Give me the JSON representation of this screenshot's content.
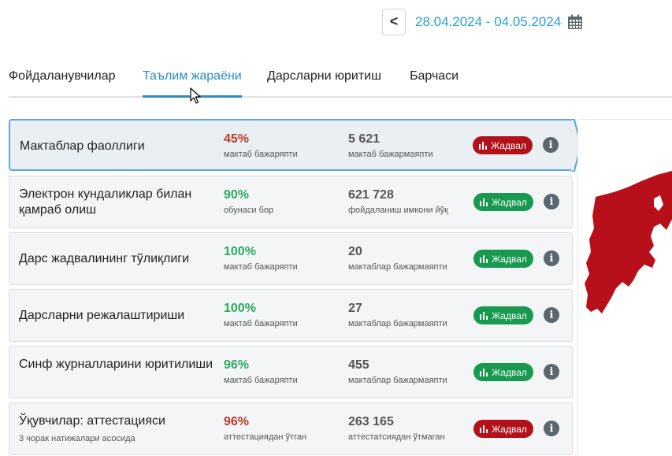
{
  "header": {
    "back_label": "<",
    "date_range": "28.04.2024 - 04.05.2024"
  },
  "tabs": [
    {
      "label": "Фойдаланувчилар"
    },
    {
      "label": "Таълим жараёни"
    },
    {
      "label": "Дарсларни юритиш"
    },
    {
      "label": "Барчаси"
    }
  ],
  "active_tab": "Таълим жараёни",
  "colors": {
    "accent": "#2a8cbf",
    "badge_red": "#b3111a",
    "badge_green": "#18994f",
    "map_red": "#b8101a"
  },
  "cards": [
    {
      "title": "Мактаблар фаоллиги",
      "subtitle": "",
      "pct": "45%",
      "pct_label": "мактаб бажаряпти",
      "pct_color": "red",
      "count": "5 621",
      "count_label": "мактаб бажармаяпти",
      "badge": "Жадвал",
      "badge_color": "red"
    },
    {
      "title": "Электрон кундаликлар билан қамраб олиш",
      "subtitle": "",
      "pct": "90%",
      "pct_label": "обунаси бор",
      "pct_color": "green",
      "count": "621 728",
      "count_label": "фойдаланиш имкони йўқ",
      "badge": "Жадвал",
      "badge_color": "green"
    },
    {
      "title": "Дарс жадвалининг тўлиқлиги",
      "subtitle": "",
      "pct": "100%",
      "pct_label": "мактаб бажаряпти",
      "pct_color": "green",
      "count": "20",
      "count_label": "мактаблар бажармаяпти",
      "badge": "Жадвал",
      "badge_color": "green"
    },
    {
      "title": "Дарсларни режалаштириши",
      "subtitle": "",
      "pct": "100%",
      "pct_label": "мактаб бажаряпти",
      "pct_color": "green",
      "count": "27",
      "count_label": "мактаблар бажармаяпти",
      "badge": "Жадвал",
      "badge_color": "green"
    },
    {
      "title": "Синф журналларини юритилиши",
      "subtitle": "",
      "pct": "96%",
      "pct_label": "мактаб бажаряпти",
      "pct_color": "green",
      "count": "455",
      "count_label": "мактаблар бажармаяпти",
      "badge": "Жадвал",
      "badge_color": "green"
    },
    {
      "title": "Ўқувчилар: аттестацияси",
      "subtitle": "3 чорак натижалари асосида",
      "pct": "96%",
      "pct_label": "аттестациядан ўтган",
      "pct_color": "red",
      "count": "263 165",
      "count_label": "аттестатсиядан ўтмаган",
      "badge": "Жадвал",
      "badge_color": "red"
    }
  ],
  "icons": {
    "back": "chevron-left-icon",
    "calendar": "calendar-icon",
    "badge": "bar-chart-icon",
    "info": "info-icon"
  }
}
